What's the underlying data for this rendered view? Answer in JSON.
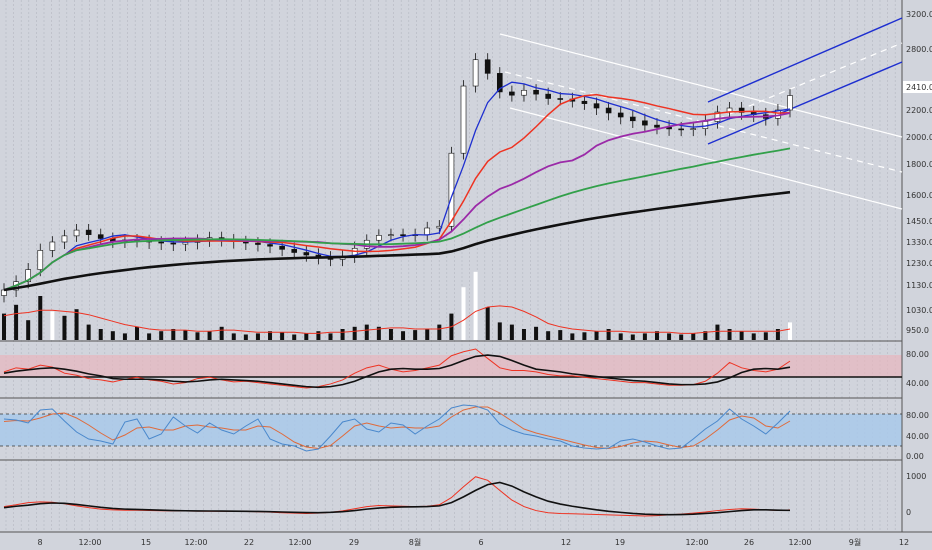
{
  "chart_data": {
    "type": "line",
    "colors": {
      "background": "#d1d4dc",
      "grid": "#b4b7c0",
      "candle_up": "#ffffff",
      "candle_down": "#111111",
      "ma5": "#1e2fd0",
      "ma10": "#ee3322",
      "ma20": "#9b2aa8",
      "ma60": "#32a04a",
      "ma120": "#111111",
      "channel_up": "#1e2fd0",
      "channel_down": "#ffffff",
      "volume_ma": "#ee3322",
      "rsi_band": "#e8b7be",
      "stoch_band": "#a9c9ea",
      "stoch_k": "#4a88cc",
      "stoch_d": "#e06a3a"
    },
    "price_axis": {
      "ticks": [
        "3200.0",
        "2800.0",
        "2410.0",
        "2200.0",
        "2000.0",
        "1800.0",
        "1600.0",
        "1450.0",
        "1330.0",
        "1230.0",
        "1130.0",
        "1030.0",
        "950.0"
      ],
      "current_label": "2410.0"
    },
    "x_axis": {
      "ticks": [
        "8",
        "12:00",
        "15",
        "12:00",
        "22",
        "12:00",
        "29",
        "8월",
        "6",
        "12",
        "19",
        "12:00",
        "26",
        "12:00",
        "9월",
        "12"
      ]
    },
    "rsi_axis": {
      "ticks": [
        "80.00",
        "40.00"
      ]
    },
    "stoch_axis": {
      "ticks": [
        "80.00",
        "40.00",
        "0.00"
      ]
    },
    "macd_axis": {
      "ticks": [
        "1000",
        "0"
      ]
    },
    "price": {
      "close": [
        1110,
        1145,
        1200,
        1290,
        1330,
        1365,
        1398,
        1372,
        1350,
        1335,
        1342,
        1338,
        1330,
        1325,
        1320,
        1328,
        1340,
        1355,
        1342,
        1332,
        1325,
        1318,
        1310,
        1295,
        1280,
        1268,
        1255,
        1247,
        1262,
        1300,
        1340,
        1368,
        1372,
        1366,
        1372,
        1410,
        1420,
        1880,
        2420,
        2690,
        2550,
        2365,
        2335,
        2380,
        2345,
        2305,
        2300,
        2280,
        2258,
        2218,
        2178,
        2148,
        2120,
        2088,
        2072,
        2060,
        2058,
        2062,
        2115,
        2185,
        2218,
        2182,
        2165,
        2138,
        2200,
        2332
      ]
    },
    "ma_series": [
      {
        "values": [
          1110,
          1128,
          1152,
          1186,
          1233,
          1268,
          1312,
          1327,
          1343,
          1364,
          1371,
          1359,
          1347,
          1336,
          1331,
          1330,
          1333,
          1336,
          1337,
          1335,
          1337,
          1334,
          1325,
          1318,
          1305,
          1291,
          1275,
          1262,
          1261,
          1267,
          1283,
          1310,
          1340,
          1361,
          1372,
          1370,
          1382,
          1588,
          1790,
          2049,
          2268,
          2395,
          2459,
          2442,
          2403,
          2381,
          2350,
          2343,
          2324,
          2300,
          2264,
          2231,
          2198,
          2162,
          2129,
          2104,
          2085,
          2073,
          2081,
          2101,
          2136,
          2153,
          2168,
          2180,
          2194,
          2209
        ]
      },
      {
        "values": [
          1110,
          1128,
          1152,
          1186,
          1233,
          1268,
          1299,
          1315,
          1331,
          1352,
          1364,
          1364,
          1355,
          1344,
          1341,
          1335,
          1336,
          1336,
          1336,
          1334,
          1335,
          1333,
          1330,
          1328,
          1321,
          1313,
          1306,
          1298,
          1292,
          1286,
          1285,
          1286,
          1290,
          1297,
          1305,
          1323,
          1346,
          1449,
          1565,
          1707,
          1819,
          1889,
          1923,
          1992,
          2076,
          2165,
          2252,
          2298,
          2330,
          2340,
          2319,
          2306,
          2289,
          2265,
          2237,
          2213,
          2189,
          2168,
          2165,
          2175,
          2186,
          2188,
          2191,
          2190,
          2177,
          2180
        ]
      },
      {
        "values": [
          1110,
          1128,
          1152,
          1186,
          1233,
          1268,
          1291,
          1305,
          1319,
          1331,
          1338,
          1344,
          1347,
          1348,
          1350,
          1350,
          1350,
          1346,
          1340,
          1343,
          1336,
          1336,
          1336,
          1336,
          1333,
          1331,
          1330,
          1324,
          1321,
          1318,
          1310,
          1307,
          1307,
          1310,
          1315,
          1325,
          1343,
          1390,
          1459,
          1536,
          1591,
          1639,
          1668,
          1705,
          1747,
          1785,
          1812,
          1826,
          1870,
          1936,
          1976,
          2003,
          2024,
          2039,
          2058,
          2078,
          2095,
          2107,
          2120,
          2136,
          2145,
          2148,
          2150,
          2152,
          2159,
          2178
        ]
      },
      {
        "values": [
          1110,
          1128,
          1152,
          1186,
          1233,
          1268,
          1291,
          1300,
          1310,
          1320,
          1328,
          1333,
          1336,
          1339,
          1341,
          1342,
          1344,
          1345,
          1346,
          1345,
          1344,
          1342,
          1340,
          1338,
          1335,
          1332,
          1327,
          1324,
          1322,
          1321,
          1319,
          1319,
          1320,
          1322,
          1324,
          1327,
          1332,
          1350,
          1378,
          1412,
          1443,
          1469,
          1494,
          1519,
          1543,
          1568,
          1592,
          1615,
          1637,
          1657,
          1675,
          1691,
          1706,
          1722,
          1738,
          1753,
          1769,
          1783,
          1800,
          1817,
          1835,
          1852,
          1869,
          1884,
          1899,
          1916
        ]
      },
      {
        "values": [
          1110,
          1118,
          1126,
          1136,
          1147,
          1158,
          1167,
          1176,
          1184,
          1191,
          1198,
          1205,
          1211,
          1216,
          1221,
          1226,
          1230,
          1234,
          1238,
          1241,
          1244,
          1247,
          1249,
          1251,
          1253,
          1255,
          1256,
          1257,
          1259,
          1260,
          1262,
          1264,
          1266,
          1268,
          1270,
          1272,
          1275,
          1285,
          1301,
          1320,
          1338,
          1355,
          1371,
          1387,
          1402,
          1416,
          1430,
          1443,
          1456,
          1468,
          1479,
          1490,
          1500,
          1510,
          1520,
          1529,
          1538,
          1547,
          1556,
          1565,
          1574,
          1583,
          1592,
          1600,
          1609,
          1618
        ]
      }
    ],
    "volume": [
      24,
      32,
      18,
      40,
      26,
      22,
      28,
      14,
      10,
      8,
      6,
      12,
      6,
      8,
      10,
      9,
      7,
      8,
      12,
      6,
      5,
      6,
      8,
      7,
      5,
      6,
      8,
      6,
      10,
      12,
      14,
      12,
      10,
      8,
      9,
      10,
      14,
      24,
      48,
      62,
      30,
      16,
      14,
      10,
      12,
      8,
      9,
      6,
      7,
      8,
      10,
      6,
      5,
      6,
      8,
      6,
      5,
      6,
      8,
      14,
      10,
      8,
      6,
      7,
      10,
      16
    ],
    "volume_highlight": [
      0,
      0,
      0,
      0,
      1,
      0,
      0,
      0,
      0,
      0,
      0,
      0,
      0,
      0,
      0,
      0,
      0,
      0,
      0,
      0,
      0,
      0,
      0,
      0,
      0,
      0,
      0,
      0,
      0,
      0,
      0,
      0,
      0,
      0,
      0,
      0,
      0,
      0,
      1,
      1,
      0,
      0,
      0,
      0,
      0,
      0,
      0,
      0,
      0,
      0,
      0,
      0,
      0,
      0,
      0,
      0,
      0,
      0,
      0,
      0,
      0,
      0,
      0,
      0,
      0,
      1
    ],
    "volume_ma": [
      22,
      24,
      25,
      27,
      27,
      26,
      25,
      23,
      20,
      17,
      14,
      12,
      10,
      9,
      9,
      9,
      8,
      8,
      9,
      9,
      8,
      7,
      7,
      7,
      7,
      6,
      6,
      7,
      7,
      8,
      9,
      10,
      11,
      11,
      10,
      10,
      10,
      12,
      18,
      26,
      30,
      31,
      30,
      26,
      21,
      15,
      12,
      10,
      9,
      8,
      8,
      8,
      7,
      7,
      7,
      7,
      6,
      6,
      7,
      8,
      8,
      8,
      8,
      8,
      8,
      10
    ],
    "rsi": {
      "k": [
        60,
        66,
        64,
        70,
        67,
        58,
        55,
        50,
        48,
        45,
        49,
        52,
        48,
        46,
        42,
        44,
        50,
        52,
        48,
        45,
        46,
        44,
        42,
        40,
        38,
        36,
        38,
        42,
        48,
        58,
        66,
        70,
        64,
        60,
        62,
        66,
        70,
        84,
        90,
        94,
        80,
        66,
        62,
        62,
        60,
        56,
        54,
        54,
        52,
        50,
        48,
        46,
        44,
        44,
        42,
        40,
        40,
        41,
        46,
        58,
        74,
        66,
        62,
        60,
        64,
        76
      ],
      "d": [
        58,
        61,
        63,
        65,
        66,
        64,
        61,
        57,
        54,
        50,
        49,
        49,
        49,
        48,
        46,
        45,
        46,
        48,
        49,
        48,
        47,
        46,
        44,
        42,
        40,
        38,
        37,
        38,
        41,
        46,
        53,
        60,
        64,
        65,
        64,
        64,
        65,
        70,
        77,
        83,
        85,
        83,
        77,
        70,
        64,
        62,
        60,
        57,
        55,
        53,
        51,
        49,
        47,
        46,
        44,
        42,
        41,
        41,
        42,
        45,
        51,
        59,
        64,
        65,
        64,
        67
      ]
    },
    "stoch": {
      "k": [
        70,
        68,
        62,
        88,
        90,
        66,
        44,
        30,
        26,
        20,
        64,
        70,
        30,
        40,
        74,
        56,
        42,
        62,
        48,
        40,
        56,
        70,
        30,
        20,
        16,
        6,
        10,
        36,
        64,
        70,
        50,
        44,
        62,
        58,
        40,
        56,
        70,
        92,
        98,
        96,
        88,
        60,
        48,
        40,
        36,
        30,
        26,
        16,
        12,
        10,
        12,
        26,
        30,
        24,
        16,
        10,
        12,
        30,
        50,
        66,
        90,
        70,
        56,
        40,
        62,
        86
      ],
      "d": [
        65,
        67,
        66,
        72,
        80,
        82,
        72,
        58,
        42,
        28,
        38,
        52,
        54,
        48,
        48,
        56,
        58,
        54,
        52,
        48,
        48,
        56,
        54,
        40,
        24,
        14,
        11,
        17,
        36,
        56,
        62,
        56,
        52,
        54,
        52,
        52,
        56,
        74,
        88,
        94,
        94,
        82,
        66,
        50,
        42,
        36,
        30,
        24,
        18,
        13,
        11,
        15,
        22,
        26,
        24,
        18,
        13,
        16,
        30,
        48,
        68,
        76,
        72,
        56,
        52,
        66
      ]
    },
    "macd": {
      "signal": [
        120,
        160,
        190,
        230,
        250,
        240,
        210,
        170,
        130,
        100,
        80,
        70,
        60,
        50,
        40,
        35,
        30,
        28,
        25,
        22,
        20,
        15,
        10,
        0,
        -10,
        -15,
        -18,
        -10,
        10,
        40,
        80,
        110,
        130,
        140,
        145,
        150,
        170,
        260,
        420,
        600,
        760,
        820,
        720,
        560,
        420,
        300,
        220,
        160,
        110,
        60,
        20,
        -10,
        -40,
        -60,
        -70,
        -75,
        -70,
        -60,
        -40,
        -20,
        10,
        40,
        60,
        60,
        50,
        45
      ],
      "hist": [
        150,
        200,
        260,
        280,
        270,
        230,
        170,
        120,
        80,
        60,
        50,
        50,
        40,
        35,
        30,
        28,
        25,
        22,
        20,
        18,
        15,
        8,
        -5,
        -20,
        -30,
        -40,
        -30,
        -10,
        30,
        90,
        150,
        180,
        170,
        160,
        150,
        160,
        200,
        400,
        700,
        980,
        880,
        600,
        330,
        150,
        40,
        -20,
        -40,
        -50,
        -60,
        -70,
        -80,
        -90,
        -100,
        -110,
        -100,
        -80,
        -60,
        -30,
        0,
        40,
        70,
        90,
        80,
        60,
        40,
        60
      ]
    }
  }
}
